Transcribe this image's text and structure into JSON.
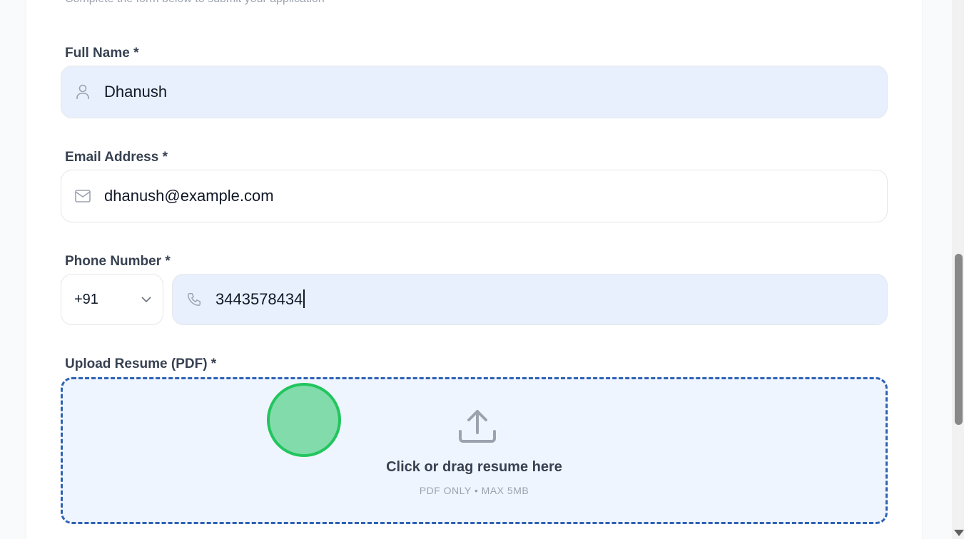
{
  "form": {
    "subtitle_cut": "Complete the form below to submit your application",
    "full_name": {
      "label": "Full Name *",
      "value": "Dhanush",
      "icon": "user-icon"
    },
    "email": {
      "label": "Email Address *",
      "value": "dhanush@example.com",
      "icon": "mail-icon"
    },
    "phone": {
      "label": "Phone Number *",
      "country_code": "+91",
      "value": "3443578434",
      "icon": "phone-icon"
    },
    "resume": {
      "label": "Upload Resume (PDF) *",
      "title": "Click or drag resume here",
      "hint": "PDF ONLY • MAX 5MB",
      "icon": "upload-icon"
    }
  },
  "colors": {
    "filled_field_bg": "#e8f0fe",
    "dropzone_border": "#2f62b3",
    "dropzone_bg": "#eff5fe",
    "cursor_marker": "#22c55e"
  }
}
